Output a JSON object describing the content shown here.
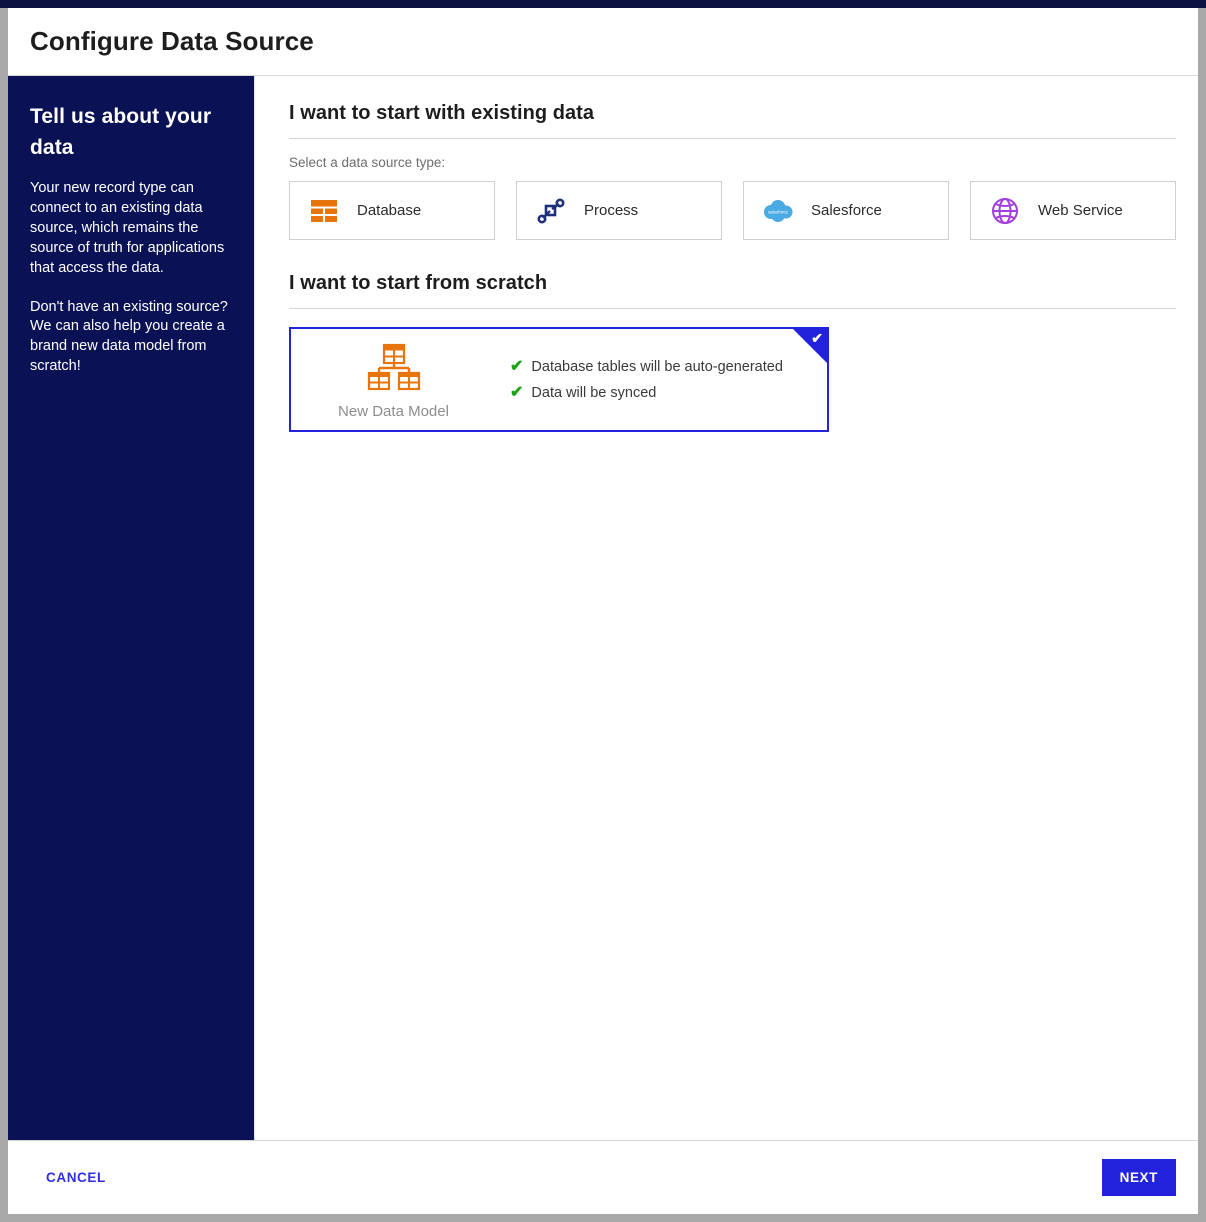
{
  "window": {
    "title": "Configure Data Source"
  },
  "sidebar": {
    "title": "Tell us about your data",
    "paragraph1": "Your new record type can connect to an existing data source, which remains the source of truth for applications that access the data.",
    "paragraph2": "Don't have an existing source? We can also help you create a brand new data model from scratch!"
  },
  "existing": {
    "heading": "I want to start with existing data",
    "select_label": "Select a data source type:",
    "cards": [
      {
        "label": "Database",
        "icon": "database-table-icon",
        "color": "#e8740c"
      },
      {
        "label": "Process",
        "icon": "process-nodes-icon",
        "color": "#1f2f7a"
      },
      {
        "label": "Salesforce",
        "icon": "salesforce-cloud-icon",
        "color": "#4aaae4"
      },
      {
        "label": "Web Service",
        "icon": "globe-icon",
        "color": "#a33ee0"
      }
    ]
  },
  "scratch": {
    "heading": "I want to start from scratch",
    "card": {
      "label": "New Data Model",
      "icon": "data-model-hierarchy-icon",
      "selected": true,
      "selected_badge_icon": "check-icon",
      "features": [
        {
          "check": "✔",
          "text": "Database tables will be auto-generated"
        },
        {
          "check": "✔",
          "text": "Data will be synced"
        }
      ]
    }
  },
  "footer": {
    "cancel_label": "CANCEL",
    "next_label": "NEXT"
  },
  "colors": {
    "sidebar_bg": "#0a1255",
    "accent_blue": "#2322dd",
    "orange": "#e8740c",
    "green_check": "#19a319",
    "purple": "#a33ee0",
    "salesforce_blue": "#4aaae4"
  }
}
